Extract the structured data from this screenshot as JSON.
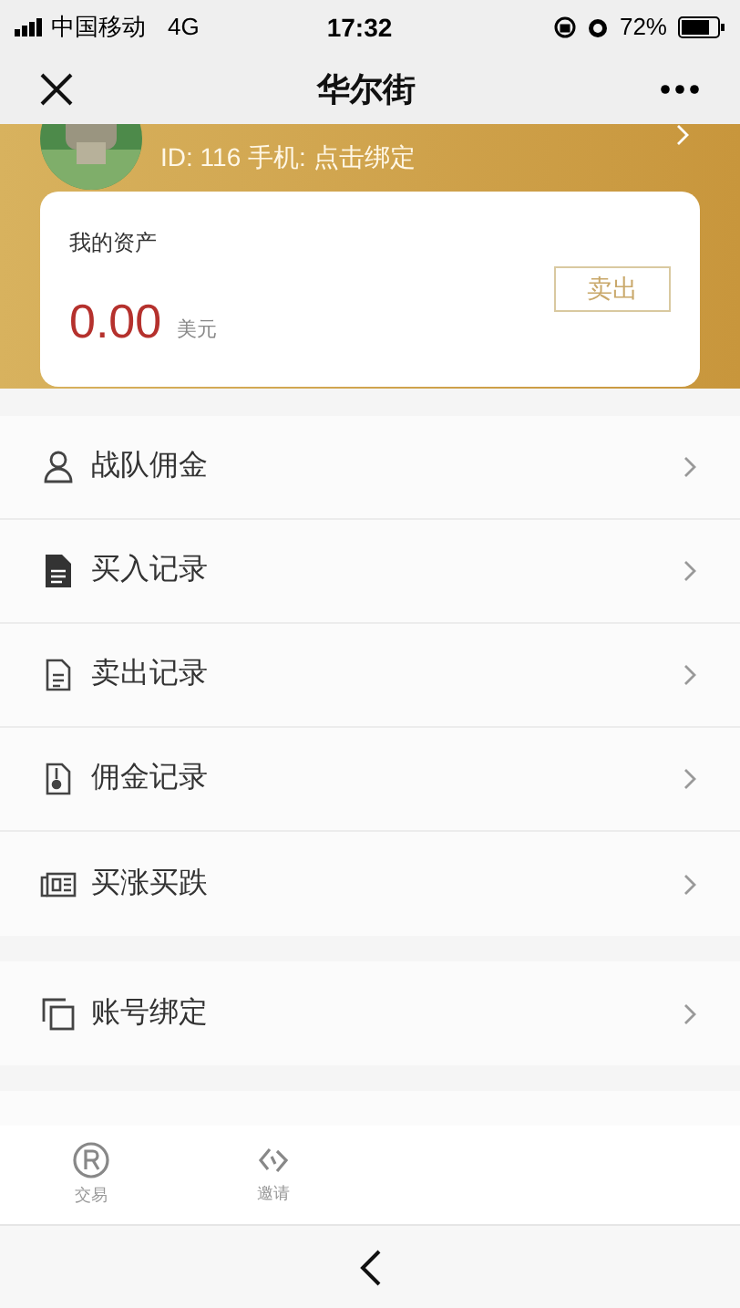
{
  "status_bar": {
    "carrier": "中国移动",
    "network": "4G",
    "time": "17:32",
    "battery": "72%"
  },
  "nav": {
    "title": "华尔街"
  },
  "profile": {
    "id_line": "ID: 116 手机: 点击绑定"
  },
  "assets": {
    "label": "我的资产",
    "amount": "0.00",
    "unit": "美元",
    "button": "卖出"
  },
  "menu_groups": [
    [
      {
        "label": "战队佣金"
      },
      {
        "label": "买入记录"
      },
      {
        "label": "卖出记录"
      },
      {
        "label": "佣金记录"
      },
      {
        "label": "买涨买跌"
      }
    ],
    [
      {
        "label": "账号绑定"
      }
    ]
  ],
  "tab_bar": [
    {
      "label": "交易"
    },
    {
      "label": "邀请"
    }
  ]
}
